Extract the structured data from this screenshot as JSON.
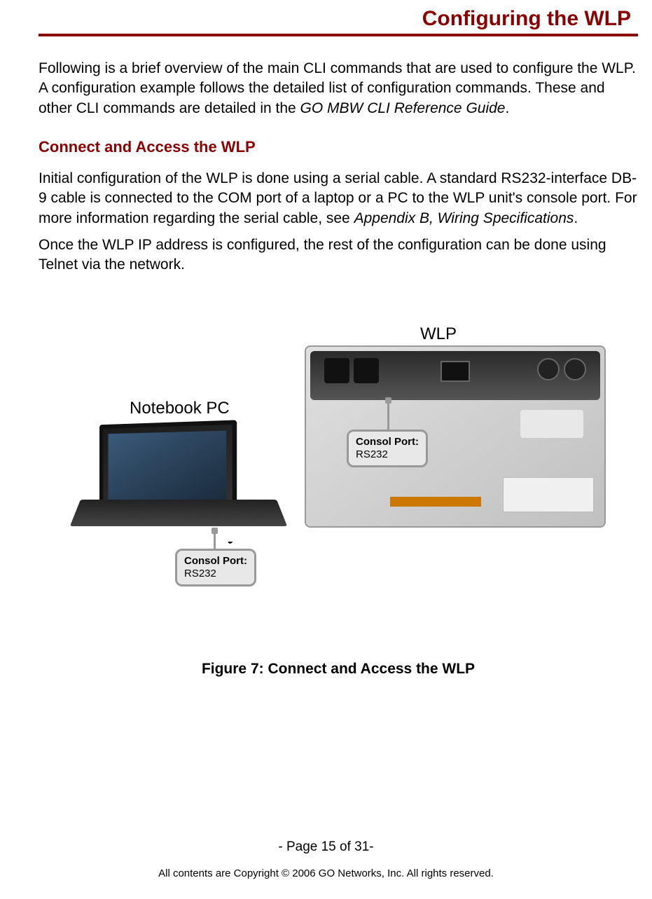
{
  "header": {
    "chapter_title": "Configuring the WLP"
  },
  "content": {
    "intro_before_italic": "Following is a brief overview of the main CLI commands that are used to configure the WLP. A configuration example follows the detailed list of configuration commands. These and other CLI commands are detailed in the ",
    "intro_italic": "GO MBW CLI Reference Guide",
    "intro_after_italic": ".",
    "section_heading": "Connect and Access the WLP",
    "para1_before_italic": "Initial configuration of the WLP is done using a serial cable. A standard RS232-interface DB-9 cable is connected to the COM port of a laptop or a PC to the WLP unit's console port. For more information regarding the serial cable, see ",
    "para1_italic": "Appendix B, Wiring Specifications",
    "para1_after_italic": ".",
    "para2": "Once the WLP IP address is configured, the rest of the configuration can be done using Telnet via the network."
  },
  "figure": {
    "label_wlp": "WLP",
    "label_notebook": "Notebook PC",
    "callout_wlp_title": "Consol Port:",
    "callout_wlp_value": "RS232",
    "callout_pc_title": "Consol Port:",
    "callout_pc_value": "RS232",
    "caption": "Figure 7: Connect and Access the WLP"
  },
  "footer": {
    "page_number": "- Page 15 of 31-",
    "copyright": "All contents are Copyright © 2006 GO Networks, Inc. All rights reserved."
  }
}
